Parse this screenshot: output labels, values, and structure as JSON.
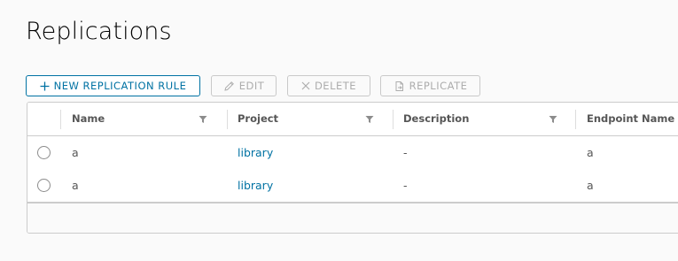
{
  "page": {
    "title": "Replications"
  },
  "toolbar": {
    "new_label": "New Replication Rule",
    "edit_label": "Edit",
    "delete_label": "Delete",
    "replicate_label": "Replicate"
  },
  "table": {
    "columns": [
      "Name",
      "Project",
      "Description",
      "Endpoint Name"
    ],
    "rows": [
      {
        "name": "a",
        "project": "library",
        "description": "-",
        "endpoint": "a"
      },
      {
        "name": "a",
        "project": "library",
        "description": "-",
        "endpoint": "a"
      }
    ]
  },
  "colors": {
    "accent": "#0072a3",
    "disabled": "#adadad"
  }
}
